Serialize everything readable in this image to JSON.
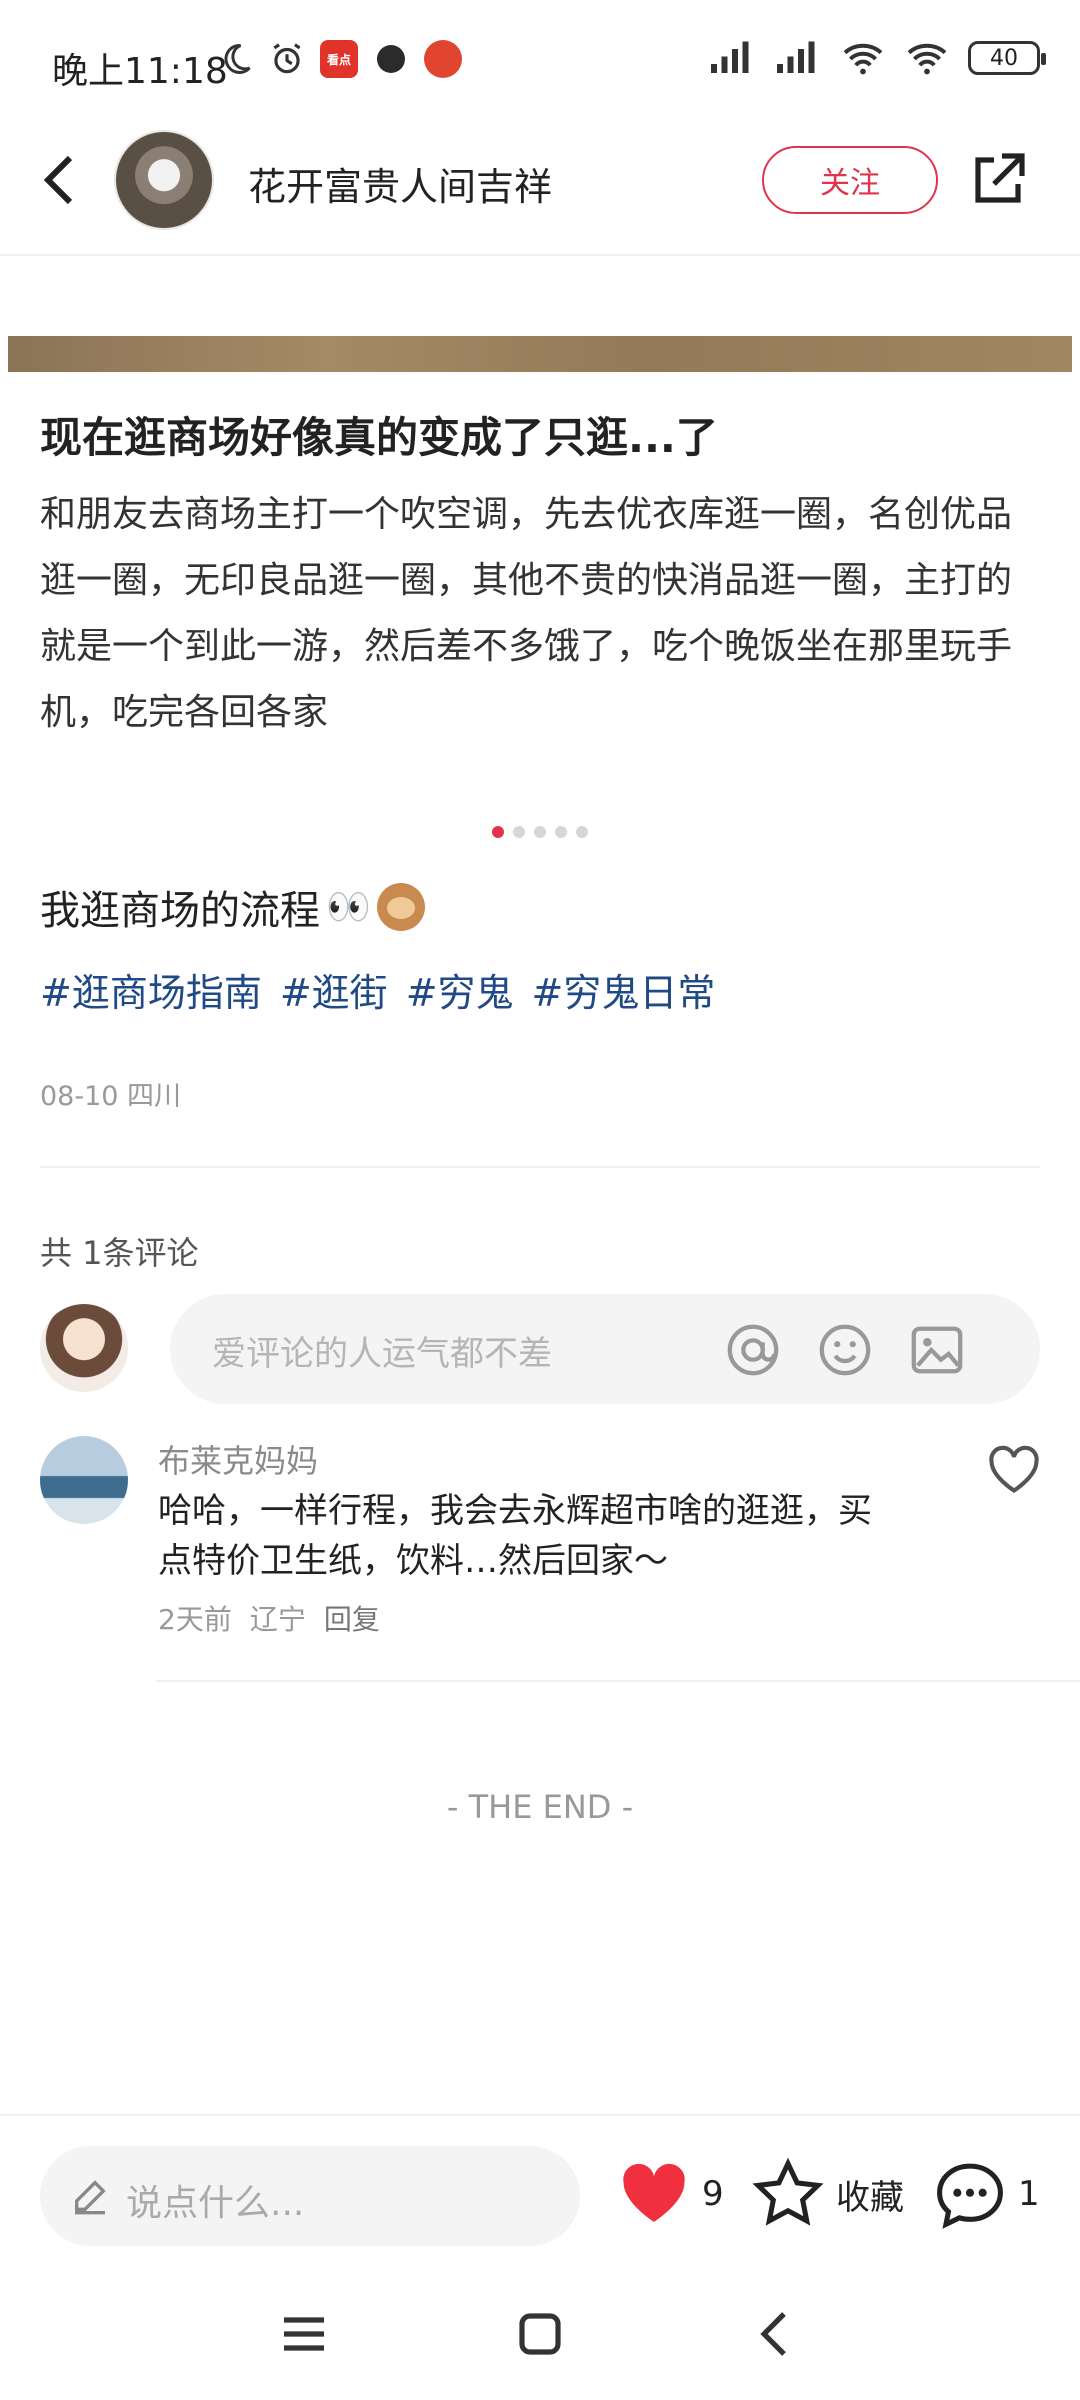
{
  "status_bar": {
    "time": "晚上11:18",
    "battery": "40",
    "app_badges": [
      {
        "name": "kandian-app-icon",
        "label": "看点",
        "color": "#e0342a"
      },
      {
        "name": "dark-app-icon",
        "label": "",
        "color": "#2b2b2b"
      },
      {
        "name": "red-app-icon",
        "label": "",
        "color": "#e2452f"
      }
    ]
  },
  "header": {
    "author_name": "花开富贵人间吉祥",
    "follow_label": "关注"
  },
  "post": {
    "heading": "现在逛商场好像真的变成了只逛...了",
    "body": "和朋友去商场主打一个吹空调，先去优衣库逛一圈，名创优品逛一圈，无印良品逛一圈，其他不贵的快消品逛一圈，主打的就是一个到此一游，然后差不多饿了，吃个晚饭坐在那里玩手机，吃完各回各家",
    "carousel_count": 5,
    "carousel_active": 1,
    "caption": "我逛商场的流程",
    "caption_emoji": "👀",
    "tags": [
      "#逛商场指南",
      "#逛街",
      "#穷鬼",
      "#穷鬼日常"
    ],
    "meta": "08-10 四川"
  },
  "comments": {
    "count_label": "共 1条评论",
    "input_placeholder": "爱评论的人运气都不差",
    "items": [
      {
        "user": "布莱克妈妈",
        "text": "哈哈，一样行程，我会去永辉超市啥的逛逛，买点特价卫生纸，饮料…然后回家～",
        "time": "2天前",
        "location": "辽宁",
        "reply_label": "回复"
      }
    ]
  },
  "end_label": "- THE END -",
  "bottom_bar": {
    "input_placeholder": "说点什么...",
    "likes": "9",
    "favorite_label": "收藏",
    "comments": "1",
    "like_color": "#f0303f"
  }
}
